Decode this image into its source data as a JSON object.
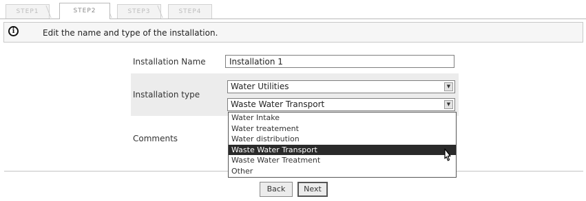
{
  "tabs": [
    {
      "label": "STEP1",
      "active": false
    },
    {
      "label": "STEP2",
      "active": true
    },
    {
      "label": "STEP3",
      "active": false
    },
    {
      "label": "STEP4",
      "active": false
    }
  ],
  "info": {
    "icon": "info-icon",
    "message": "Edit the name and type of the installation."
  },
  "form": {
    "name_label": "Installation Name",
    "name_value": "Installation 1",
    "type_label": "Installation type",
    "type_value": "Water Utilities",
    "subtype_value": "Waste Water Transport",
    "subtype_options": [
      "Water Intake",
      "Water treatement",
      "Water distribution",
      "Waste Water Transport",
      "Waste Water Treatment",
      "Other"
    ],
    "subtype_selected_index": 3,
    "comments_label": "Comments"
  },
  "buttons": {
    "back": "Back",
    "next": "Next"
  }
}
